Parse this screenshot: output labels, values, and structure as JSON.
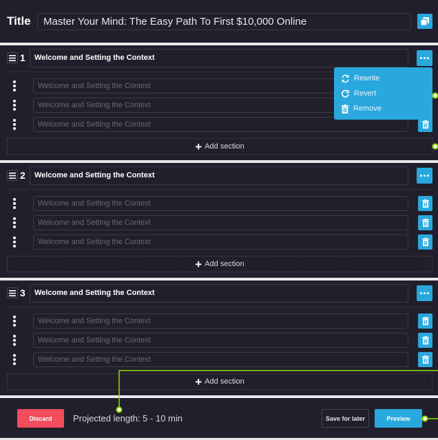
{
  "header": {
    "title_label": "Title",
    "title_value": "Master Your Mind: The Easy Path To First $10,000 Online",
    "copy_icon": "copy-icon"
  },
  "sections": [
    {
      "number": "1",
      "title": "Welcome and Setting the Context",
      "items": [
        {
          "placeholder": "Welcome and Setting the Context"
        },
        {
          "placeholder": "Welcome and Setting the Context"
        },
        {
          "placeholder": "Welcome and Setting the Context"
        }
      ],
      "add_label": "Add section"
    },
    {
      "number": "2",
      "title": "Welcome and Setting the Context",
      "items": [
        {
          "placeholder": "Welcome and Setting the Context"
        },
        {
          "placeholder": "Welcome and Setting the Context"
        },
        {
          "placeholder": "Welcome and Setting the Context"
        }
      ],
      "add_label": "Add section"
    },
    {
      "number": "3",
      "title": "Welcome and Setting the Context",
      "items": [
        {
          "placeholder": "Welcome and Setting the Context"
        },
        {
          "placeholder": "Welcome and Setting the Context"
        },
        {
          "placeholder": "Welcome and Setting the Context"
        }
      ],
      "add_label": "Add section"
    }
  ],
  "menu": {
    "items": [
      {
        "label": "Rewrite",
        "icon": "rewrite-icon"
      },
      {
        "label": "Revert",
        "icon": "revert-icon"
      },
      {
        "label": "Remove",
        "icon": "trash-icon"
      }
    ]
  },
  "footer": {
    "discard_label": "Discard",
    "projected_length": "Projected length: 5 - 10 min",
    "save_label": "Save for later",
    "preview_label": "Preview"
  },
  "colors": {
    "accent": "#29a8dd",
    "danger": "#f24c5d",
    "background": "#221f2c",
    "annotation": "#8ee000"
  }
}
